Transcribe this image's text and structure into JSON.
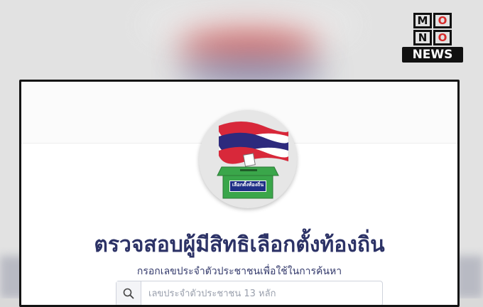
{
  "logo": {
    "row1": [
      "M",
      "O"
    ],
    "row2": [
      "N",
      "O"
    ],
    "word": "NEWS"
  },
  "emblem": {
    "icon": "flag-ballot-box-icon",
    "box_label": "เลือกตั้งท้องถิ่น"
  },
  "page": {
    "title": "ตรวจสอบผู้มีสิทธิเลือกตั้งท้องถิ่น",
    "subtitle": "กรอกเลขประจำตัวประชาชนเพื่อใช้ในการค้นหา"
  },
  "search": {
    "icon": "search-icon",
    "placeholder": "เลขประจำตัวประชาชน 13 หลัก",
    "value": ""
  },
  "colors": {
    "title": "#2c3266",
    "flag_red": "#d8283a",
    "flag_blue": "#2d2a7d",
    "ballot_green": "#3aa64a",
    "label_blue": "#1e2f86"
  }
}
